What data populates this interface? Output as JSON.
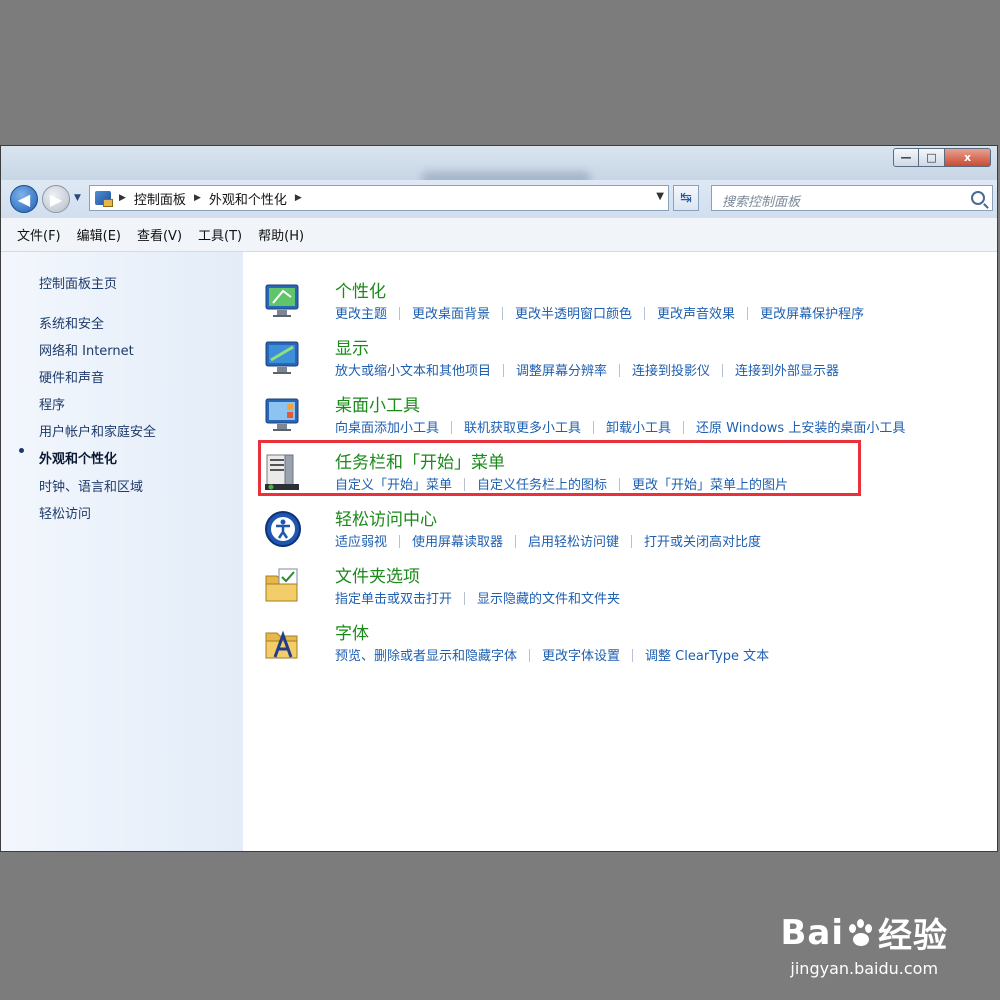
{
  "window": {
    "controls": {
      "minimize": "—",
      "maximize": "□",
      "close": "x"
    }
  },
  "nav": {
    "back_glyph": "◀",
    "forward_glyph": "▶",
    "history_glyph": "▼",
    "breadcrumb": [
      "控制面板",
      "外观和个性化"
    ],
    "breadcrumb_sep": "▶",
    "dropdown_glyph": "▼",
    "refresh_glyph": "↹",
    "search_placeholder": "搜索控制面板"
  },
  "menubar": [
    "文件(F)",
    "编辑(E)",
    "查看(V)",
    "工具(T)",
    "帮助(H)"
  ],
  "sidebar": {
    "home": "控制面板主页",
    "items": [
      "系统和安全",
      "网络和 Internet",
      "硬件和声音",
      "程序",
      "用户帐户和家庭安全",
      "外观和个性化",
      "时钟、语言和区域",
      "轻松访问"
    ],
    "active_index": 5
  },
  "categories": [
    {
      "title": "个性化",
      "icon": "personalization-icon",
      "links": [
        "更改主题",
        "更改桌面背景",
        "更改半透明窗口颜色",
        "更改声音效果",
        "更改屏幕保护程序"
      ]
    },
    {
      "title": "显示",
      "icon": "display-icon",
      "links": [
        "放大或缩小文本和其他项目",
        "调整屏幕分辨率",
        "连接到投影仪",
        "连接到外部显示器"
      ]
    },
    {
      "title": "桌面小工具",
      "icon": "gadgets-icon",
      "links": [
        "向桌面添加小工具",
        "联机获取更多小工具",
        "卸载小工具",
        "还原 Windows 上安装的桌面小工具"
      ]
    },
    {
      "title": "任务栏和「开始」菜单",
      "icon": "taskbar-icon",
      "links": [
        "自定义「开始」菜单",
        "自定义任务栏上的图标",
        "更改「开始」菜单上的图片"
      ]
    },
    {
      "title": "轻松访问中心",
      "icon": "ease-of-access-icon",
      "links": [
        "适应弱视",
        "使用屏幕读取器",
        "启用轻松访问键",
        "打开或关闭高对比度"
      ]
    },
    {
      "title": "文件夹选项",
      "icon": "folder-options-icon",
      "links": [
        "指定单击或双击打开",
        "显示隐藏的文件和文件夹"
      ]
    },
    {
      "title": "字体",
      "icon": "fonts-icon",
      "links": [
        "预览、删除或者显示和隐藏字体",
        "更改字体设置",
        "调整 ClearType 文本"
      ]
    }
  ],
  "highlight_color": "#e8313a",
  "watermark": {
    "logo_left": "Bai",
    "logo_right": "经验",
    "url": "jingyan.baidu.com"
  }
}
